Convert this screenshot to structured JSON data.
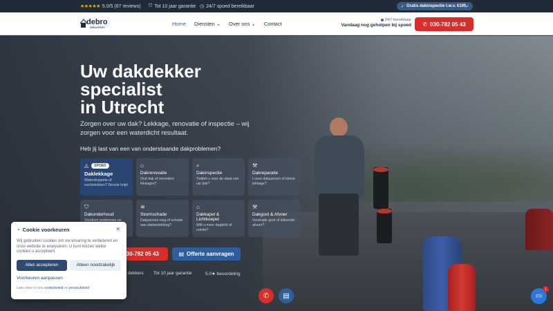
{
  "topbar": {
    "rating": "5.0/5 (67 reviews)",
    "guarantee": "Tot 10 jaar garantie",
    "available": "24/7 spoed bereikbaar",
    "promo": "Gratis dakinspectie t.w.v. €105,-"
  },
  "nav": {
    "logo_word": "debro",
    "logo_sub": "dakwerken",
    "links": [
      "Home",
      "Diensten",
      "Over ons",
      "Contact"
    ],
    "avail_small": "24/7 bereikbaar",
    "avail_strong": "Vandaag nog geholpen bij spoed",
    "phone": "030-782 05 43"
  },
  "hero": {
    "title_line1": "Uw dakdekker",
    "title_line2": "specialist",
    "title_line3": "in Utrecht",
    "subtitle": "Zorgen over uw dak? Lekkage, renovatie of inspectie – wij zorgen voor een waterdicht resultaat.",
    "question": "Heb jij last van een van onderstaande dakproblemen?",
    "cards": [
      {
        "badge": "SPOED",
        "title": "Daklekkage",
        "desc": "Waterdruppels of vochtvlekken? Directe hulp!"
      },
      {
        "title": "Dakrenovatie",
        "desc": "Oud dak of meerdere lekkages?"
      },
      {
        "title": "Dakinspectie",
        "desc": "Twijfelt u over de staat van uw dak?"
      },
      {
        "title": "Dakreparatie",
        "desc": "Losse dakpannen of kleine lekkage?"
      },
      {
        "title": "Dakonderhoud",
        "desc": "Voorkom problemen en"
      },
      {
        "title": "Stormschade",
        "desc": "Dakpannen weg of schade aan dakbedekking?"
      },
      {
        "title": "Dakkapel & Lichtkoepel",
        "desc": "Wilt u meer daglicht of ruimte?"
      },
      {
        "title": "Dakgoot & Afvoer",
        "desc": "Verstopte goot of lekkende afvoer?"
      }
    ],
    "cta_phone": "030-782 05 43",
    "cta_quote": "Offerte aanvragen",
    "stats": [
      "dekkers",
      "Tot 10 jaar garantie",
      "5.0★ beoordeling"
    ]
  },
  "cookie": {
    "title": "Cookie voorkeuren",
    "text": "Wij gebruiken cookies om uw ervaring te verbeteren en onze website te analyseren. U kunt kiezen welke cookies u accepteert.",
    "accept": "Alles accepteren",
    "necessary": "Alleen noodzakelijk",
    "prefs": "Voorkeuren aanpassen",
    "more_prefix": "Lees meer in ons",
    "cookie_link": "cookiebeleid",
    "and": "en",
    "privacy_link": "privacybeleid"
  },
  "chat": {
    "count": "1"
  },
  "colors": {
    "accent_red": "#d62e2b",
    "accent_blue": "#2e5f9c",
    "navy": "#1e2f44",
    "star": "#f5b400"
  }
}
